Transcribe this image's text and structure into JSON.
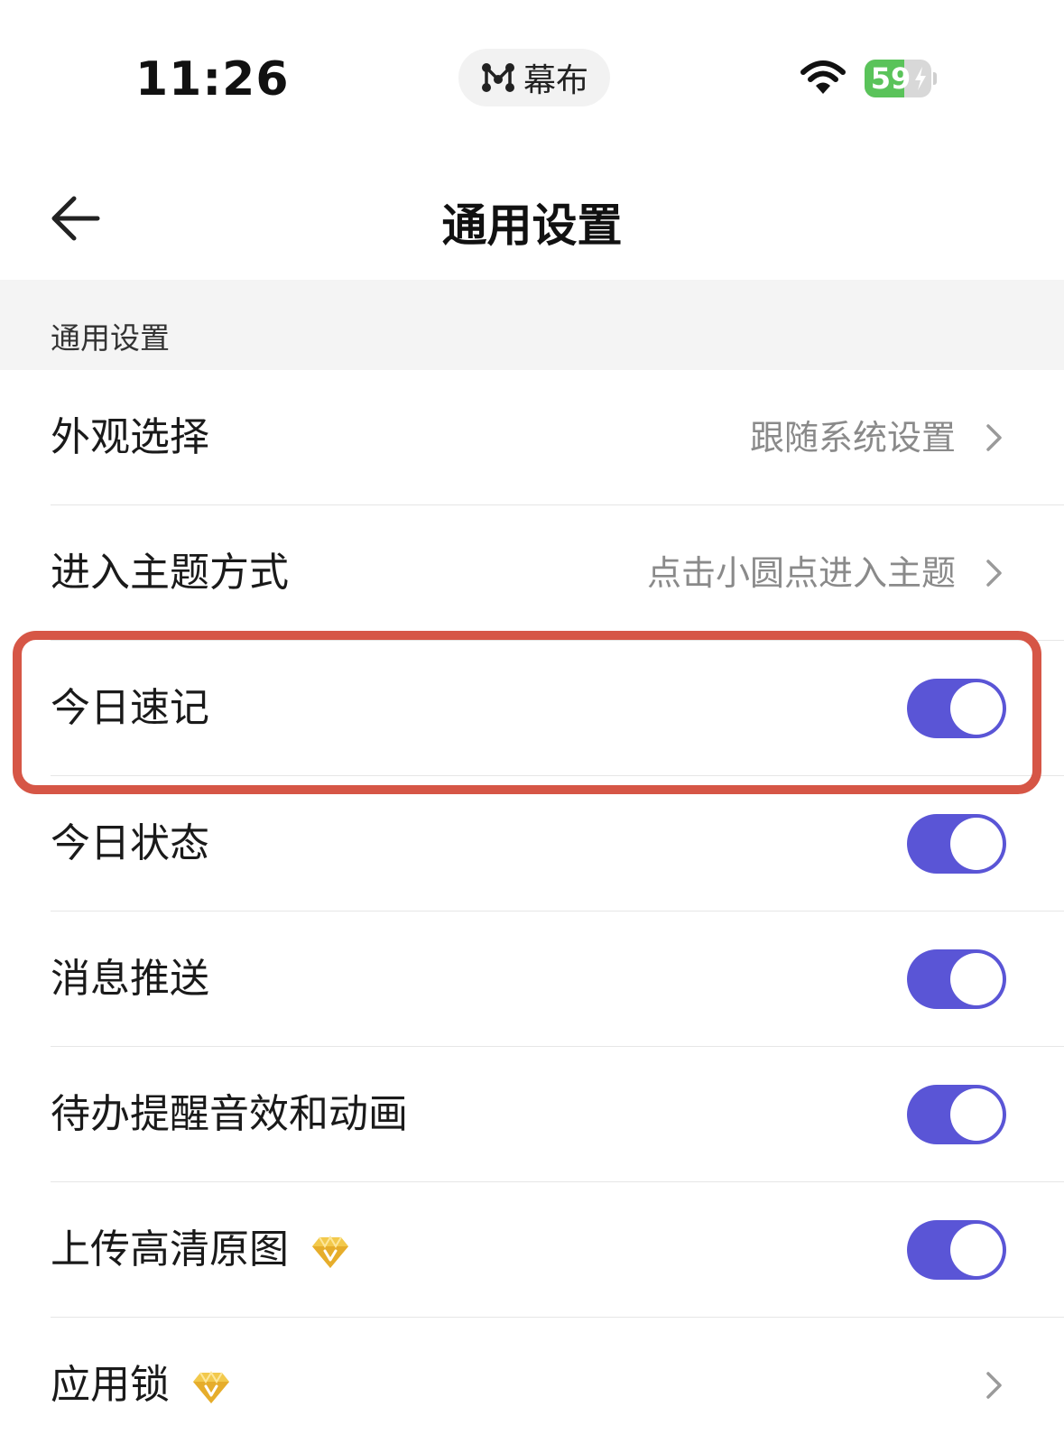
{
  "status_bar": {
    "time": "11:26",
    "app_name": "幕布",
    "battery_level": "59",
    "battery_percent": 59,
    "icons": [
      "mubu-logo-icon",
      "wifi-icon",
      "battery-icon",
      "bolt-icon"
    ]
  },
  "nav": {
    "title": "通用设置",
    "back_icon": "arrow-left-icon"
  },
  "section": {
    "header": "通用设置"
  },
  "rows": [
    {
      "label": "外观选择",
      "value": "跟随系统设置",
      "type": "link"
    },
    {
      "label": "进入主题方式",
      "value": "点击小圆点进入主题",
      "type": "link"
    },
    {
      "label": "今日速记",
      "type": "toggle",
      "on": true
    },
    {
      "label": "今日状态",
      "type": "toggle",
      "on": true
    },
    {
      "label": "消息推送",
      "type": "toggle",
      "on": true
    },
    {
      "label": "待办提醒音效和动画",
      "type": "toggle",
      "on": true
    },
    {
      "label": "上传高清原图",
      "type": "toggle",
      "on": true,
      "vip": true
    },
    {
      "label": "应用锁",
      "type": "link",
      "vip": true
    }
  ],
  "colors": {
    "toggle_on": "#5a55d6",
    "highlight": "#d65646",
    "battery_green": "#5ac35a",
    "vip_gold": "#f2c94c"
  }
}
